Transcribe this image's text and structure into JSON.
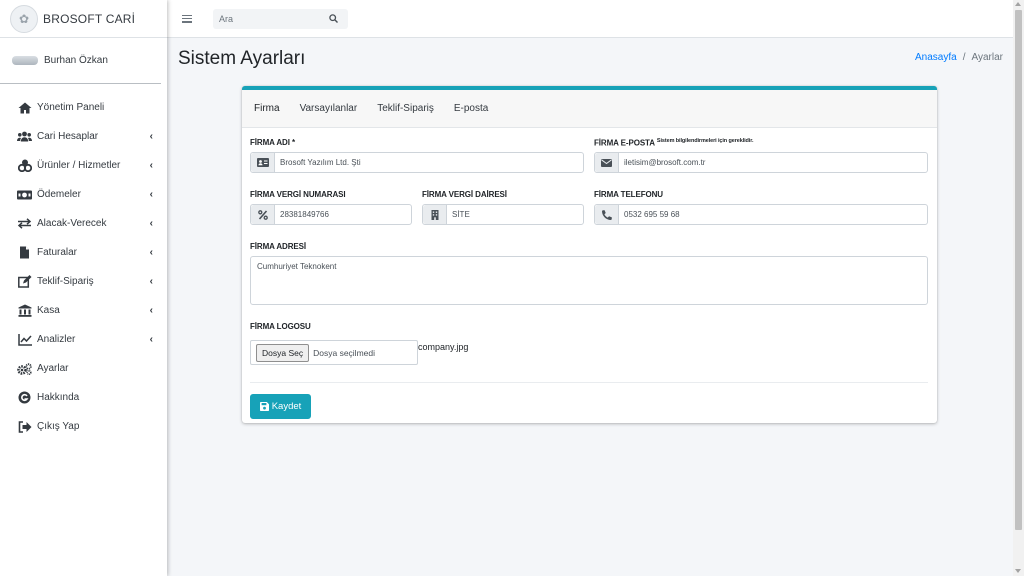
{
  "app": {
    "brand": "BROSOFT CARİ",
    "user_name": "Burhan Özkan"
  },
  "search": {
    "placeholder": "Ara"
  },
  "sidebar": {
    "items": [
      {
        "label": "Yönetim Paneli",
        "icon": "home-icon",
        "has_submenu": false
      },
      {
        "label": "Cari Hesaplar",
        "icon": "users-icon",
        "has_submenu": true
      },
      {
        "label": "Ürünler / Hizmetler",
        "icon": "product-icon",
        "has_submenu": true
      },
      {
        "label": "Ödemeler",
        "icon": "money-icon",
        "has_submenu": true
      },
      {
        "label": "Alacak-Verecek",
        "icon": "exchange-icon",
        "has_submenu": true
      },
      {
        "label": "Faturalar",
        "icon": "file-icon",
        "has_submenu": true
      },
      {
        "label": "Teklif-Sipariş",
        "icon": "edit-icon",
        "has_submenu": true
      },
      {
        "label": "Kasa",
        "icon": "bank-icon",
        "has_submenu": true
      },
      {
        "label": "Analizler",
        "icon": "chart-icon",
        "has_submenu": true
      },
      {
        "label": "Ayarlar",
        "icon": "cogs-icon",
        "has_submenu": false
      },
      {
        "label": "Hakkında",
        "icon": "info-icon",
        "has_submenu": false
      },
      {
        "label": "Çıkış Yap",
        "icon": "sign-out-icon",
        "has_submenu": false
      }
    ]
  },
  "page": {
    "title": "Sistem Ayarları",
    "breadcrumb": {
      "home": "Anasayfa",
      "separator": "/",
      "current": "Ayarlar"
    }
  },
  "tabs": [
    "Firma",
    "Varsayılanlar",
    "Teklif-Sipariş",
    "E-posta"
  ],
  "form": {
    "company_name": {
      "label": "FİRMA ADI *",
      "value": "Brosoft Yazılım Ltd. Şti"
    },
    "company_email": {
      "label": "FİRMA E-POSTA",
      "hint": "Sistem bilgilendirmeleri için gereklidir.",
      "value": "iletisim@brosoft.com.tr"
    },
    "tax_number": {
      "label": "FİRMA VERGİ NUMARASI",
      "value": "28381849766"
    },
    "tax_office": {
      "label": "FİRMA VERGİ DAİRESİ",
      "value": "SİTE"
    },
    "phone": {
      "label": "FİRMA TELEFONU",
      "value": "0532 695 59 68"
    },
    "address": {
      "label": "FİRMA ADRESİ",
      "value": "Cumhuriyet Teknokent"
    },
    "logo": {
      "label": "FİRMA LOGOSU",
      "button": "Dosya Seç",
      "status": "Dosya seçilmedi",
      "current_file": "company.jpg"
    },
    "save_label": "Kaydet"
  },
  "colors": {
    "accent": "#17a2b8",
    "link": "#007bff"
  }
}
